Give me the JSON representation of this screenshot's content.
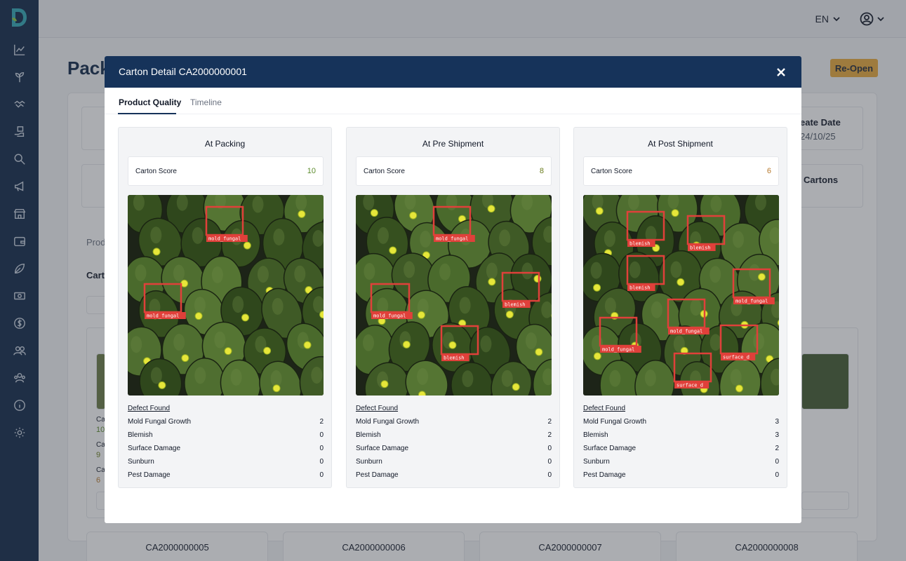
{
  "app": {
    "brand_letter": "D"
  },
  "topbar": {
    "language": "EN"
  },
  "page": {
    "title": "Pack",
    "reopen_label": "Re-Open"
  },
  "background": {
    "create_date_label": "eate Date",
    "create_date_value": "24/10/25",
    "cartons_label": "Cartons",
    "prod_tab": "Prod",
    "carton_label": "Carto",
    "card_labels": [
      "Ca",
      "10",
      "Ca",
      "9",
      "Ca",
      "6"
    ],
    "bottom_cards": [
      "CA2000000005",
      "CA2000000006",
      "CA2000000007",
      "CA2000000008"
    ]
  },
  "modal": {
    "title": "Carton Detail CA2000000001",
    "tabs": [
      "Product Quality",
      "Timeline"
    ],
    "score_label": "Carton Score",
    "defect_heading": "Defect Found",
    "stages": [
      {
        "title": "At Packing",
        "score": "10",
        "score_color": "#5b8a2b",
        "detections": [
          "mold_fungal",
          "mold_fungal"
        ],
        "defects": [
          {
            "name": "Mold Fungal Growth",
            "count": "2"
          },
          {
            "name": "Blemish",
            "count": "0"
          },
          {
            "name": "Surface Damage",
            "count": "0"
          },
          {
            "name": "Sunburn",
            "count": "0"
          },
          {
            "name": "Pest Damage",
            "count": "0"
          }
        ]
      },
      {
        "title": "At Pre Shipment",
        "score": "8",
        "score_color": "#6b7d1e",
        "detections": [
          "mold_fungal",
          "mold_fungal",
          "blemish",
          "blemish"
        ],
        "defects": [
          {
            "name": "Mold Fungal Growth",
            "count": "2"
          },
          {
            "name": "Blemish",
            "count": "2"
          },
          {
            "name": "Surface Damage",
            "count": "0"
          },
          {
            "name": "Sunburn",
            "count": "0"
          },
          {
            "name": "Pest Damage",
            "count": "0"
          }
        ]
      },
      {
        "title": "At Post Shipment",
        "score": "6",
        "score_color": "#b7792d",
        "detections": [
          "blemish",
          "blemish",
          "blemish",
          "mold_fungal",
          "mold_fungal",
          "mold_fungal",
          "surface_d",
          "surface_d"
        ],
        "defects": [
          {
            "name": "Mold Fungal Growth",
            "count": "3"
          },
          {
            "name": "Blemish",
            "count": "3"
          },
          {
            "name": "Surface Damage",
            "count": "2"
          },
          {
            "name": "Sunburn",
            "count": "0"
          },
          {
            "name": "Pest Damage",
            "count": "0"
          }
        ]
      }
    ]
  }
}
